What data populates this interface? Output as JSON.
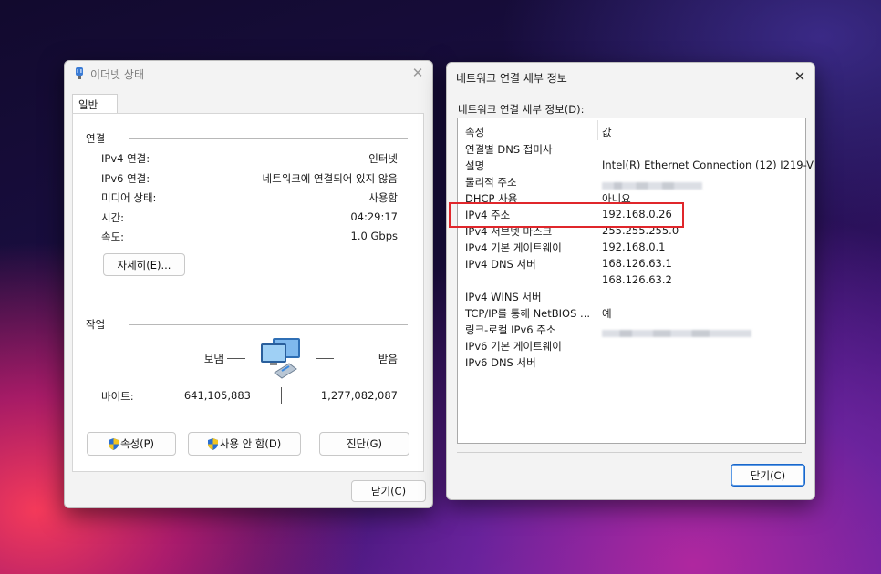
{
  "ethernet_status": {
    "title": "이더넷 상태",
    "tab": "일반",
    "connection": {
      "header": "연결",
      "rows": [
        {
          "label": "IPv4 연결:",
          "value": "인터넷"
        },
        {
          "label": "IPv6 연결:",
          "value": "네트워크에 연결되어 있지 않음"
        },
        {
          "label": "미디어 상태:",
          "value": "사용함"
        },
        {
          "label": "시간:",
          "value": "04:29:17"
        },
        {
          "label": "속도:",
          "value": "1.0 Gbps"
        }
      ],
      "details_button": "자세히(E)..."
    },
    "activity": {
      "header": "작업",
      "sent_label": "보냄",
      "received_label": "받음",
      "bytes_label": "바이트:",
      "bytes_sent": "641,105,883",
      "bytes_received": "1,277,082,087"
    },
    "buttons": {
      "properties": "속성(P)",
      "disable": "사용 안 함(D)",
      "diagnose": "진단(G)",
      "close": "닫기(C)"
    }
  },
  "network_details": {
    "title": "네트워크 연결 세부 정보",
    "list_label": "네트워크 연결 세부 정보(D):",
    "columns": {
      "property": "속성",
      "value": "값"
    },
    "rows": [
      {
        "property": "연결별 DNS 접미사",
        "value": ""
      },
      {
        "property": "설명",
        "value": "Intel(R) Ethernet Connection (12) I219-V"
      },
      {
        "property": "물리적 주소",
        "value": ""
      },
      {
        "property": "DHCP 사용",
        "value": "아니요"
      },
      {
        "property": "IPv4 주소",
        "value": "192.168.0.26"
      },
      {
        "property": "IPv4 서브넷 마스크",
        "value": "255.255.255.0"
      },
      {
        "property": "IPv4 기본 게이트웨이",
        "value": "192.168.0.1"
      },
      {
        "property": "IPv4 DNS 서버",
        "value": "168.126.63.1"
      },
      {
        "property": "",
        "value": "168.126.63.2"
      },
      {
        "property": "IPv4 WINS 서버",
        "value": ""
      },
      {
        "property": "TCP/IP를 통해 NetBIOS ...",
        "value": "예"
      },
      {
        "property": "링크-로컬 IPv6 주소",
        "value": ""
      },
      {
        "property": "IPv6 기본 게이트웨이",
        "value": ""
      },
      {
        "property": "IPv6 DNS 서버",
        "value": ""
      }
    ],
    "close_button": "닫기(C)"
  },
  "colors": {
    "highlight": "#e0262b",
    "primary_button_border": "#1a66c9"
  }
}
